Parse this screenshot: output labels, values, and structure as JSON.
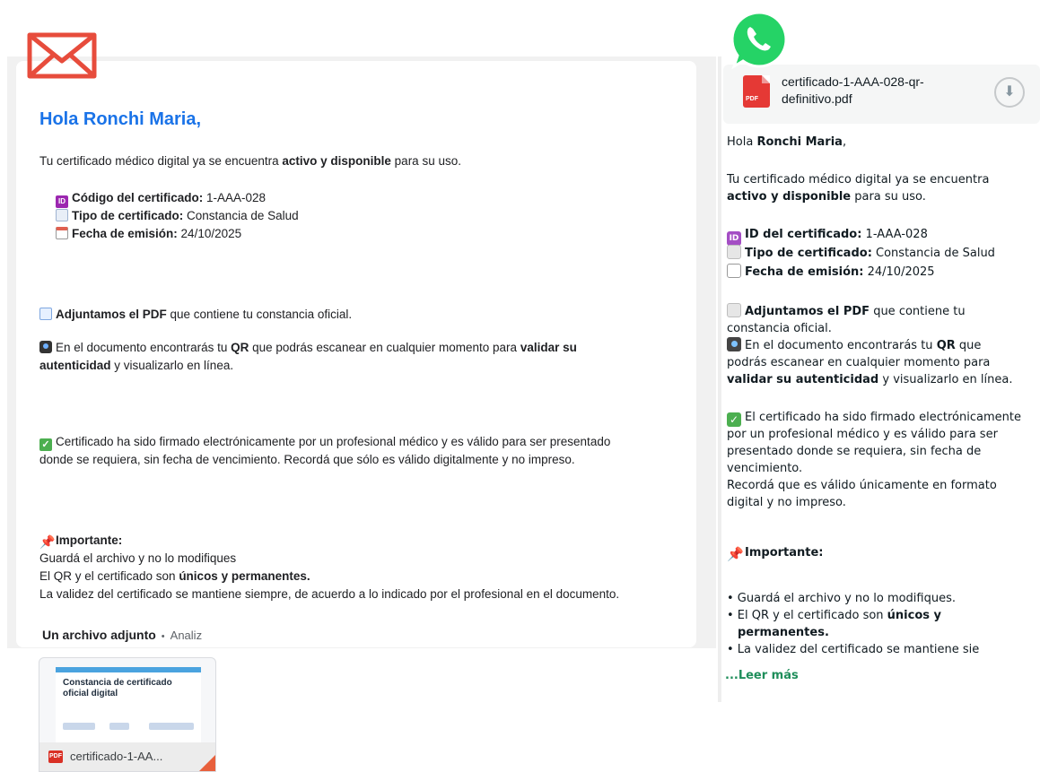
{
  "email": {
    "greeting": "Hola Ronchi Maria,",
    "intro_prefix": "Tu certificado médico digital ya se encuentra ",
    "intro_bold": "activo y disponible",
    "intro_suffix": " para su uso.",
    "code_label": "Código del certificado:",
    "code_value": " 1-AAA-028",
    "type_label": "Tipo de certificado:",
    "type_value": " Constancia de Salud",
    "date_label": "Fecha de emisión:",
    "date_value": " 24/10/2025",
    "pdf_bold": "Adjuntamos el PDF",
    "pdf_rest": " que contiene tu constancia oficial.",
    "qr_prefix": "En el documento encontrarás tu ",
    "qr_bold": "QR",
    "qr_mid": " que podrás escanear en cualquier momento para ",
    "qr_bold2": "validar su",
    "qr_line2_bold": "autenticidad",
    "qr_line2_rest": " y visualizarlo en línea.",
    "signed_line1": "Certificado ha sido firmado electrónicamente por un profesional médico y es válido para ser presentado",
    "signed_line2": "donde se requiera, sin fecha de vencimiento. Recordá que sólo es válido digitalmente y no impreso.",
    "important_label": "Importante:",
    "important_1": "Guardá el archivo y no lo modifiques",
    "important_2_prefix": "El QR y el certificado son ",
    "important_2_bold": "únicos y permanentes.",
    "important_3": "La validez del certificado se mantiene siempre, de acuerdo a lo indicado por el profesional en el documento.",
    "attach_count": "Un archivo adjunto",
    "attach_secondary": "Analiz",
    "thumb_title": "Constancia de certificado oficial digital",
    "thumb_filename": "certificado-1-AA...",
    "pdf_badge": "PDF"
  },
  "whatsapp": {
    "file_name": "certificado-1-AAA-028-qr-\ndefinitivo.pdf",
    "pdf_badge": "PDF",
    "greeting_prefix": "Hola ",
    "greeting_bold": "Ronchi Maria",
    "greeting_suffix": ",",
    "intro_line1": "Tu certificado médico digital ya se encuentra",
    "intro_bold": "activo y disponible",
    "intro_suffix": " para su uso.",
    "id_label": "ID del certificado:",
    "id_value": " 1-AAA-028",
    "type_label": "Tipo de certificado:",
    "type_value": " Constancia de Salud",
    "date_label": "Fecha de emisión:",
    "date_value": " 24/10/2025",
    "pdf_bold": "Adjuntamos el PDF",
    "pdf_rest": " que contiene tu",
    "pdf_line2": "constancia oficial.",
    "qr_prefix": "En el documento encontrarás tu ",
    "qr_bold": "QR",
    "qr_suffix": " que",
    "qr_line2": "podrás escanear en cualquier momento para",
    "qr_line3_bold": "validar su autenticidad",
    "qr_line3_rest": " y visualizarlo en línea.",
    "signed_line1": "El certificado ha sido firmado electrónicamente",
    "signed_line2": "por un profesional médico y es válido para ser",
    "signed_line3": "presentado donde se requiera, sin fecha de",
    "signed_line4": "vencimiento.",
    "signed_line5": "Recordá que es válido únicamente en formato",
    "signed_line6": "digital y no impreso.",
    "important_label": "Importante:",
    "bullet_1": "• Guardá el archivo y no lo modifiques.",
    "bullet_2_prefix": "• El QR y el certificado son ",
    "bullet_2_bold": "únicos y",
    "bullet_2_line2": "permanentes.",
    "bullet_3": "• La validez del certificado se mantiene sie",
    "read_more": "...Leer más"
  },
  "colors": {
    "gmail_blue": "#1a73e8",
    "whatsapp_green": "#25d366",
    "read_more_green": "#1f8e5b",
    "mail_icon_red": "#e74c3c"
  },
  "icons": [
    "mail-icon",
    "whatsapp-logo-icon",
    "id-icon",
    "page-icon",
    "calendar-icon",
    "memo-icon",
    "camera-icon",
    "check-icon",
    "pushpin-icon",
    "pdf-icon",
    "download-icon"
  ]
}
